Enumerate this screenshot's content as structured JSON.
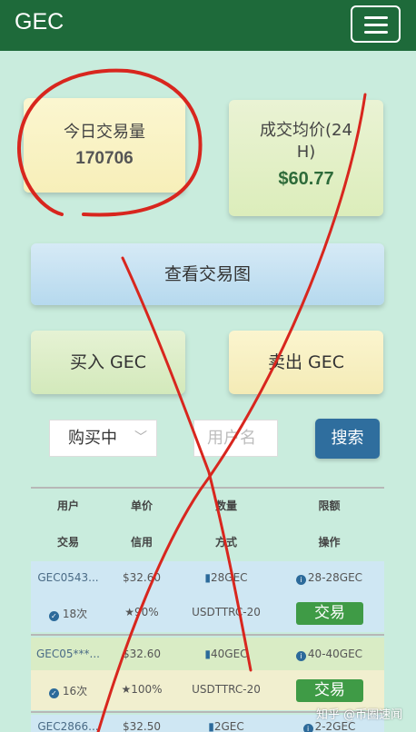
{
  "header": {
    "brand": "GEC",
    "menu_icon": "hamburger-icon"
  },
  "stats": {
    "volume": {
      "title": "今日交易量",
      "value": "170706"
    },
    "avg_price": {
      "title_line1": "成交均价(24",
      "title_line2": "H)",
      "value": "$60.77"
    }
  },
  "actions": {
    "chart": "查看交易图",
    "buy": "买入 GEC",
    "sell": "卖出 GEC"
  },
  "filter": {
    "mode_selected": "购买中",
    "username_placeholder": "用户名",
    "search_label": "搜索"
  },
  "table": {
    "headers_top": [
      "用户",
      "单价",
      "数量",
      "限额"
    ],
    "headers_bottom": [
      "交易",
      "信用",
      "方式",
      "操作"
    ],
    "rows": [
      {
        "user": "GEC0543...",
        "price": "$32.60",
        "qty": "28GEC",
        "limit": "28-28GEC",
        "trades": "18次",
        "credit": "★90%",
        "method": "USDTTRC-20",
        "action": "交易"
      },
      {
        "user": "GEC05***...",
        "price": "$32.60",
        "qty": "40GEC",
        "limit": "40-40GEC",
        "trades": "16次",
        "credit": "★100%",
        "method": "USDTTRC-20",
        "action": "交易"
      },
      {
        "user": "GEC2866...",
        "price": "$32.50",
        "qty": "2GEC",
        "limit": "2-2GEC"
      }
    ]
  },
  "watermark": "知乎 @币圈速闻",
  "colors": {
    "header": "#1e6a3a",
    "page_bg": "#c9ecdd",
    "search_btn": "#2f6e9e",
    "trade_btn": "#3f9b46",
    "annotation": "#d8261e"
  }
}
